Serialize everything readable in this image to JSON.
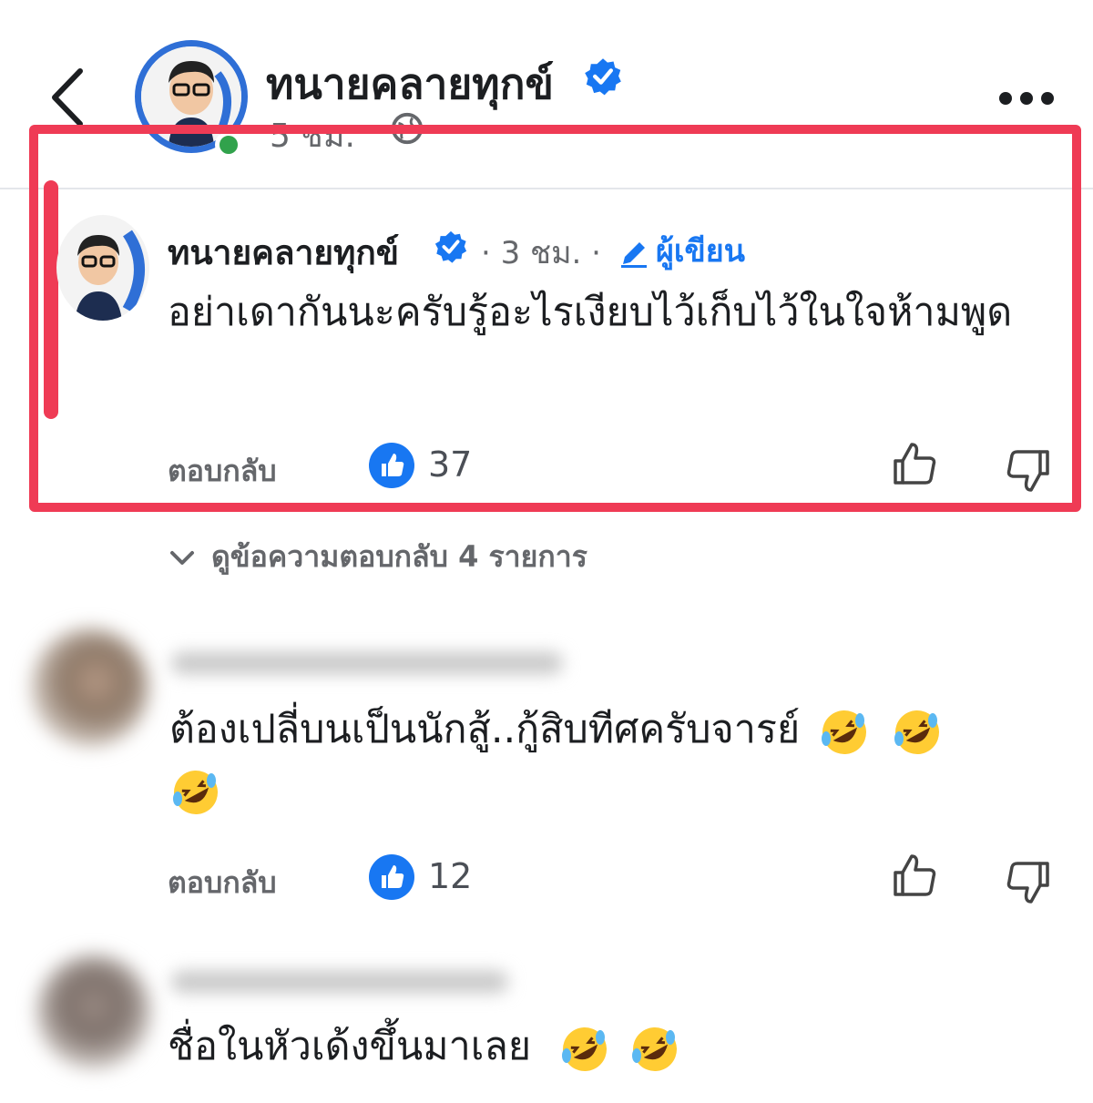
{
  "header": {
    "page_name": "ทนายคลายทุกข์",
    "time": "5 ชม.",
    "back_icon": "chevron-left-icon",
    "more_icon": "more-horizontal-icon",
    "globe_icon": "globe-icon"
  },
  "comments": [
    {
      "author": "ทนายคลายทุกข์",
      "meta": "· 3 ชม. ·",
      "badge": "ผู้เขียน",
      "text": "อย่าเดากันนะครับรู้อะไรเงียบไว้เก็บไว้ในใจห้ามพูด",
      "reply_label": "ตอบกลับ",
      "like_count": "37"
    },
    {
      "author": "",
      "text": "ต้องเปลี่บนเป็นนักสู้..กู้สิบทีศครับจารย์",
      "emoji_count": 3,
      "reply_label": "ตอบกลับ",
      "like_count": "12"
    },
    {
      "author": "",
      "text": "ชื่อในหัวเด้งขึ้นมาเลย",
      "emoji_count": 2
    }
  ],
  "view_replies": "ดูข้อความตอบกลับ 4 รายการ",
  "colors": {
    "accent": "#1877f2",
    "highlight": "#ef3b55",
    "online": "#31a24c",
    "muted": "#65676b"
  }
}
